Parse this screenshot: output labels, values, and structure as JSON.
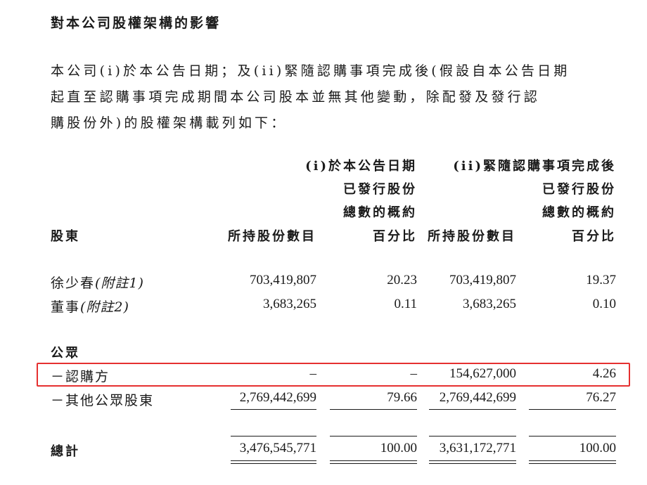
{
  "heading": "對本公司股權架構的影響",
  "paragraph": [
    "本公司(i)於本公告日期；及(ii)緊隨認購事項完成後(假設自本公告日期",
    "起直至認購事項完成期間本公司股本並無其他變動，除配發及發行認",
    "購股份外)的股權架構載列如下："
  ],
  "table": {
    "group_i": [
      "(i)於本公告日期",
      "已發行股份",
      "總數的概約"
    ],
    "group_ii": [
      "(ii)緊隨認購事項完成後",
      "已發行股份",
      "總數的概約"
    ],
    "col_shareholder": "股東",
    "col_shares_1": "所持股份數目",
    "col_pct_1": "百分比",
    "col_shares_2": "所持股份數目",
    "col_pct_2": "百分比",
    "rows": [
      {
        "name": "徐少春",
        "note": "(附註1)",
        "shares1": "703,419,807",
        "pct1": "20.23",
        "shares2": "703,419,807",
        "pct2": "19.37"
      },
      {
        "name": "董事",
        "note": "(附註2)",
        "shares1": "3,683,265",
        "pct1": "0.11",
        "shares2": "3,683,265",
        "pct2": "0.10"
      }
    ],
    "public_label": "公眾",
    "public_rows": [
      {
        "name": "－認購方",
        "shares1": "–",
        "pct1": "–",
        "shares2": "154,627,000",
        "pct2": "4.26"
      },
      {
        "name": "－其他公眾股東",
        "shares1": "2,769,442,699",
        "pct1": "79.66",
        "shares2": "2,769,442,699",
        "pct2": "76.27"
      }
    ],
    "total": {
      "name": "總計",
      "shares1": "3,476,545,771",
      "pct1": "100.00",
      "shares2": "3,631,172,771",
      "pct2": "100.00"
    }
  },
  "highlight_color": "#e53030"
}
